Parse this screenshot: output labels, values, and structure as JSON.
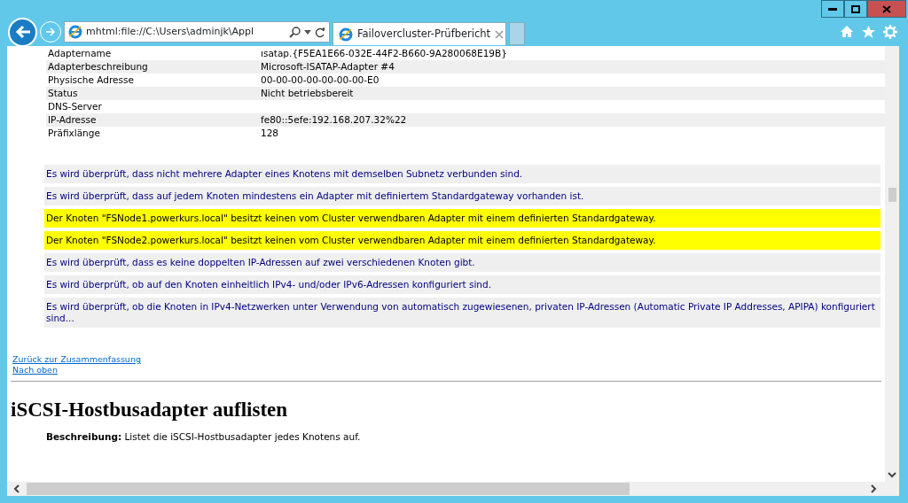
{
  "browser": {
    "address": "mhtml:file://C:\\Users\\adminjk\\Appl",
    "tabs": [
      {
        "label": "Failovercluster-Prüfbericht",
        "selected": true
      }
    ]
  },
  "adapter_table": [
    {
      "label": "Adaptername",
      "value": "ısatap.{F5EA1E66-032E-44F2-B660-9A280068E19B}"
    },
    {
      "label": "Adapterbeschreibung",
      "value": "Microsoft-ISATAP-Adapter #4"
    },
    {
      "label": "Physische Adresse",
      "value": "00-00-00-00-00-00-00-E0"
    },
    {
      "label": "Status",
      "value": "Nicht betriebsbereit"
    },
    {
      "label": "DNS-Server"
    },
    {
      "label": "IP-Adresse",
      "value": "fe80::5efe:192.168.207.32%22"
    },
    {
      "label": "Präfixlänge",
      "value": "128"
    }
  ],
  "messages": [
    {
      "kind": "info",
      "text": "Es wird überprüft, dass nicht mehrere Adapter eines Knotens mit demselben Subnetz verbunden sind."
    },
    {
      "kind": "info",
      "text": "Es wird überprüft, dass auf jedem Knoten mindestens ein Adapter mit definiertem Standardgateway vorhanden ist."
    },
    {
      "kind": "warning",
      "text": "Der Knoten \"FSNode1.powerkurs.local\" besitzt keinen vom Cluster verwendbaren Adapter mit einem definierten Standardgateway."
    },
    {
      "kind": "warning",
      "text": "Der Knoten \"FSNode2.powerkurs.local\" besitzt keinen vom Cluster verwendbaren Adapter mit einem definierten Standardgateway."
    },
    {
      "kind": "info",
      "text": "Es wird überprüft, dass es keine doppelten IP-Adressen auf zwei verschiedenen Knoten gibt."
    },
    {
      "kind": "info",
      "text": "Es wird überprüft, ob auf den Knoten einheitlich IPv4- und/oder IPv6-Adressen konfiguriert sind."
    },
    {
      "kind": "info",
      "text": "Es wird überprüft, ob die Knoten in IPv4-Netzwerken unter Verwendung von automatisch zugewiesenen, privaten IP-Adressen (Automatic Private IP Addresses, APIPA) konfiguriert sind..."
    }
  ],
  "links": [
    "Zurück zur Zusammenfassung",
    "Nach oben"
  ],
  "section": {
    "heading": "iSCSI-Hostbusadapter auflisten",
    "description": "**Beschreibung:** Listet die iSCSI-Hostbusadapter jedes Knotens auf."
  }
}
